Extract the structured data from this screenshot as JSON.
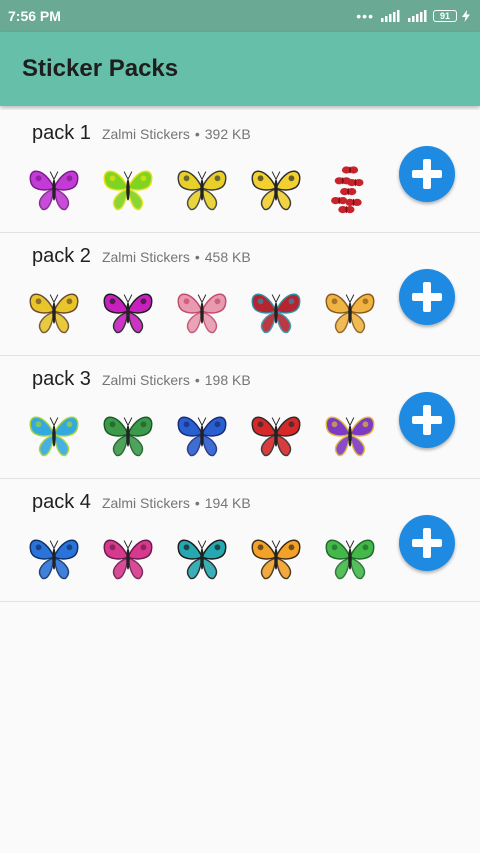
{
  "status_bar": {
    "time": "7:56 PM",
    "battery": "91",
    "icons": [
      "dots-icon",
      "signal-icon",
      "signal-icon",
      "battery-icon",
      "charging-icon"
    ]
  },
  "app_bar": {
    "title": "Sticker Packs"
  },
  "colors": {
    "status_bar": "#6aaa95",
    "app_bar": "#66bfa8",
    "add_button": "#1e8ae2"
  },
  "packs": [
    {
      "name": "pack 1",
      "publisher": "Zalmi Stickers",
      "separator": "•",
      "size": "392 KB",
      "stickers": [
        {
          "icon": "butterfly-sticker",
          "wing": "#c43ad6",
          "accent": "#7a1a8a"
        },
        {
          "icon": "butterfly-sticker",
          "wing": "#7fd321",
          "accent": "#e6e10f"
        },
        {
          "icon": "butterfly-sticker",
          "wing": "#e8d028",
          "accent": "#3b3b3b"
        },
        {
          "icon": "butterfly-sticker",
          "wing": "#f2d030",
          "accent": "#2a2a2a"
        },
        {
          "icon": "butterfly-cluster-sticker",
          "wing": "#c8232b",
          "accent": "#7a0f12"
        }
      ]
    },
    {
      "name": "pack 2",
      "publisher": "Zalmi Stickers",
      "separator": "•",
      "size": "458 KB",
      "stickers": [
        {
          "icon": "butterfly-sticker",
          "wing": "#e8c52a",
          "accent": "#6a4a2a"
        },
        {
          "icon": "butterfly-sticker",
          "wing": "#c81fbf",
          "accent": "#1e1e1e"
        },
        {
          "icon": "butterfly-sticker",
          "wing": "#e89ab0",
          "accent": "#c24a6a"
        },
        {
          "icon": "butterfly-sticker",
          "wing": "#b5252f",
          "accent": "#2f8fa8"
        },
        {
          "icon": "butterfly-sticker",
          "wing": "#f0b444",
          "accent": "#8a5a18"
        }
      ]
    },
    {
      "name": "pack 3",
      "publisher": "Zalmi Stickers",
      "separator": "•",
      "size": "198 KB",
      "stickers": [
        {
          "icon": "butterfly-sticker",
          "wing": "#34a9e0",
          "accent": "#a4d232"
        },
        {
          "icon": "butterfly-sticker",
          "wing": "#3c9a4a",
          "accent": "#1b5a27"
        },
        {
          "icon": "butterfly-sticker",
          "wing": "#2a5fd0",
          "accent": "#1a2a7a"
        },
        {
          "icon": "butterfly-sticker",
          "wing": "#d62828",
          "accent": "#2a2a2a"
        },
        {
          "icon": "butterfly-sticker",
          "wing": "#7d3ac4",
          "accent": "#e0b830"
        }
      ]
    },
    {
      "name": "pack 4",
      "publisher": "Zalmi Stickers",
      "separator": "•",
      "size": "194 KB",
      "stickers": [
        {
          "icon": "butterfly-sticker",
          "wing": "#2a73d8",
          "accent": "#0f2f6a"
        },
        {
          "icon": "butterfly-sticker",
          "wing": "#d6398e",
          "accent": "#6a1a4a"
        },
        {
          "icon": "butterfly-sticker",
          "wing": "#25a8b0",
          "accent": "#1a1a1a"
        },
        {
          "icon": "butterfly-sticker",
          "wing": "#f2a22a",
          "accent": "#3a2a12"
        },
        {
          "icon": "butterfly-sticker",
          "wing": "#45b84a",
          "accent": "#1e6a2a"
        }
      ]
    }
  ]
}
